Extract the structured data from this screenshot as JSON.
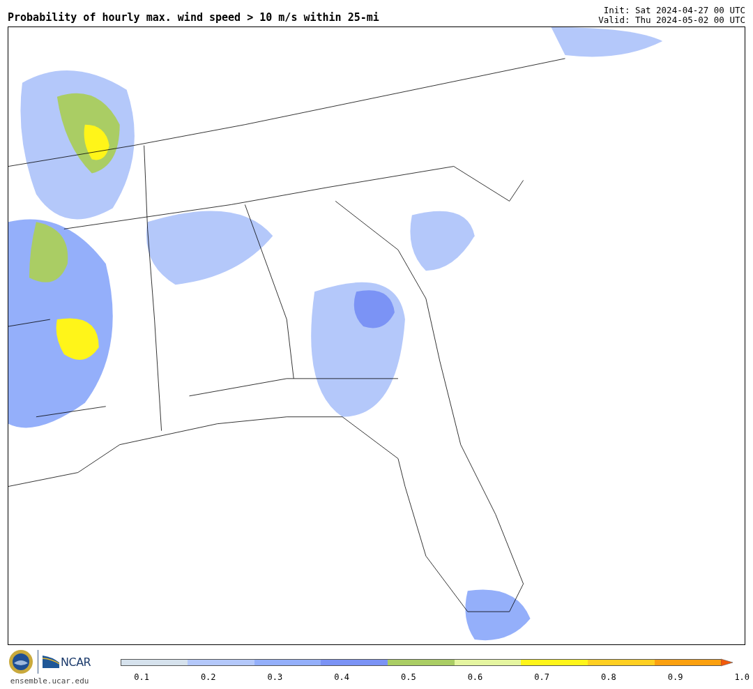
{
  "header": {
    "title": "Probability of hourly max. wind speed > 10 m/s within 25-mi",
    "init": "Init: Sat 2024-04-27 00 UTC",
    "valid": "Valid: Thu 2024-05-02 00 UTC"
  },
  "footer": {
    "logo_text": "NCAR",
    "url": "ensemble.ucar.edu"
  },
  "colorbar": {
    "bins": [
      {
        "color": "#d6e2ed"
      },
      {
        "color": "#b4c8fa"
      },
      {
        "color": "#94affa"
      },
      {
        "color": "#7b93f5"
      },
      {
        "color": "#aacd64"
      },
      {
        "color": "#e5f5a0"
      },
      {
        "color": "#fff519"
      },
      {
        "color": "#fecf21"
      },
      {
        "color": "#fba00f"
      }
    ],
    "extend": {
      "color": "#f25a0c"
    },
    "ticks": [
      "0.1",
      "0.2",
      "0.3",
      "0.4",
      "0.5",
      "0.6",
      "0.7",
      "0.8",
      "0.9",
      "1.0"
    ]
  }
}
